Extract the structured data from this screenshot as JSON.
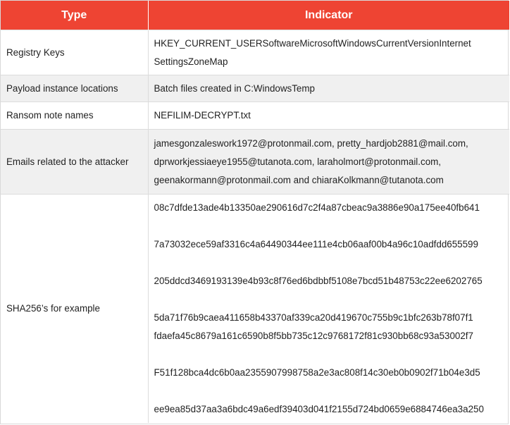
{
  "table": {
    "headers": [
      "Type",
      "Indicator"
    ],
    "rows": [
      {
        "type": "Registry Keys",
        "indicator_lines": [
          "HKEY_CURRENT_USERSoftwareMicrosoftWindowsCurrentVersionInternet",
          "SettingsZoneMap"
        ]
      },
      {
        "type": "Payload instance locations",
        "indicator_lines": [
          "Batch files created in C:WindowsTemp"
        ]
      },
      {
        "type": "Ransom note names",
        "indicator_lines": [
          "NEFILIM-DECRYPT.txt"
        ]
      },
      {
        "type": "Emails related to the attacker",
        "indicator_lines": [
          "jamesgonzaleswork1972@protonmail.com, pretty_hardjob2881@mail.com,",
          "dprworkjessiaeye1955@tutanota.com, laraholmort@protonmail.com,",
          "geenakormann@protonmail.com and chiaraKolkmann@tutanota.com"
        ]
      },
      {
        "type": "SHA256’s for example",
        "hashes": [
          "08c7dfde13ade4b13350ae290616d7c2f4a87cbeac9a3886e90a175ee40fb641",
          "7a73032ece59af3316c4a64490344ee111e4cb06aaf00b4a96c10adfdd655599",
          "205ddcd3469193139e4b93c8f76ed6bdbbf5108e7bcd51b48753c22ee6202765",
          "5da71f76b9caea411658b43370af339ca20d419670c755b9c1bfc263b78f07f1",
          "fdaefa45c8679a161c6590b8f5bb735c12c9768172f81c930bb68c93a53002f7",
          "F51f128bca4dc6b0aa2355907998758a2e3ac808f14c30eb0b0902f71b04e3d5",
          "ee9ea85d37aa3a6bdc49a6edf39403d041f2155d724bd0659e6884746ea3a250"
        ]
      }
    ]
  }
}
